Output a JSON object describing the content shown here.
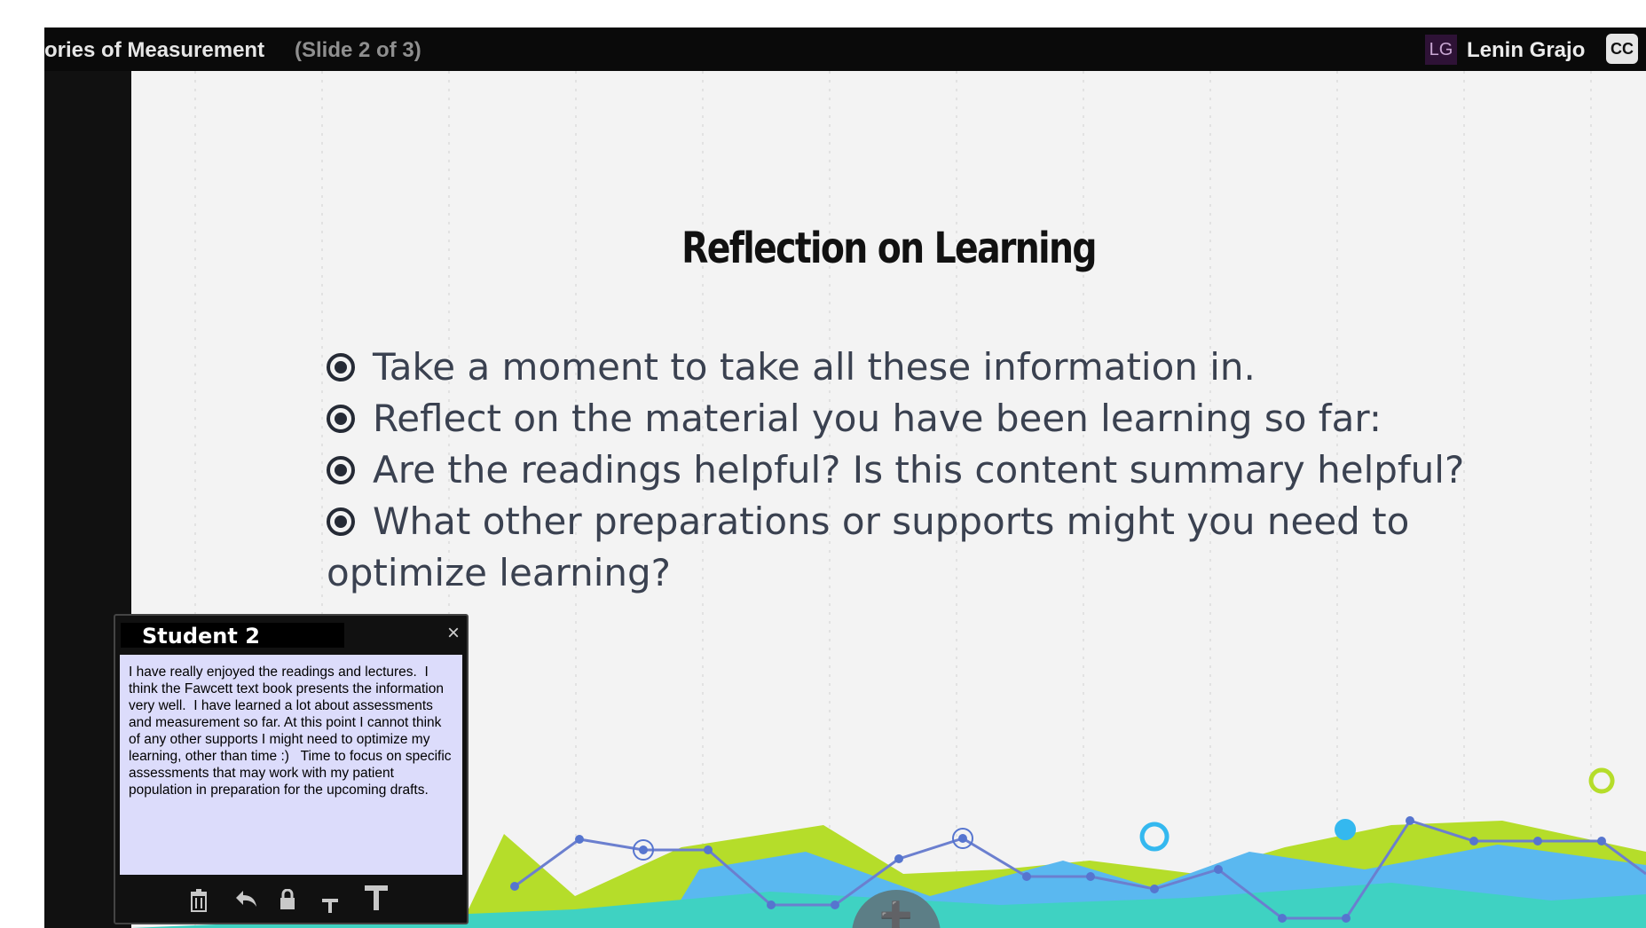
{
  "window": {
    "title": "ories of Measurement",
    "slide_counter": "(Slide 2 of 3)",
    "user_initials": "LG",
    "user_name": "Lenin Grajo",
    "cc_label": "CC"
  },
  "slide": {
    "title": "Reflection on Learning",
    "bullets": [
      "Take a moment to take all these information in.",
      "Reflect on the material you have been learning so far:",
      "Are the readings helpful?  Is this content summary helpful?",
      "What other preparations or supports might you need to"
    ],
    "bullet_continuation": "optimize learning?"
  },
  "note": {
    "title": "Student 2",
    "close_icon": "×",
    "body": "I have really enjoyed the readings and lectures.  I think the Fawcett text book presents the information very well.  I have learned a lot about assessments and measurement so far. At this point I cannot think of any other supports I might need to optimize my learning, other than time :)   Time to focus on specific assessments that may work with my patient population in preparation for the upcoming drafts.",
    "toolbar_icons": [
      "trash-icon",
      "reply-icon",
      "lock-icon",
      "text-small-icon",
      "text-large-icon"
    ]
  },
  "colors": {
    "topbar": "#0a0a0a",
    "slide_bg": "#f3f3f3",
    "note_body": "#dcdcfb",
    "accent_green": "#b5dd2a",
    "accent_teal": "#3fd2c2",
    "accent_blue": "#5ab8f0"
  }
}
